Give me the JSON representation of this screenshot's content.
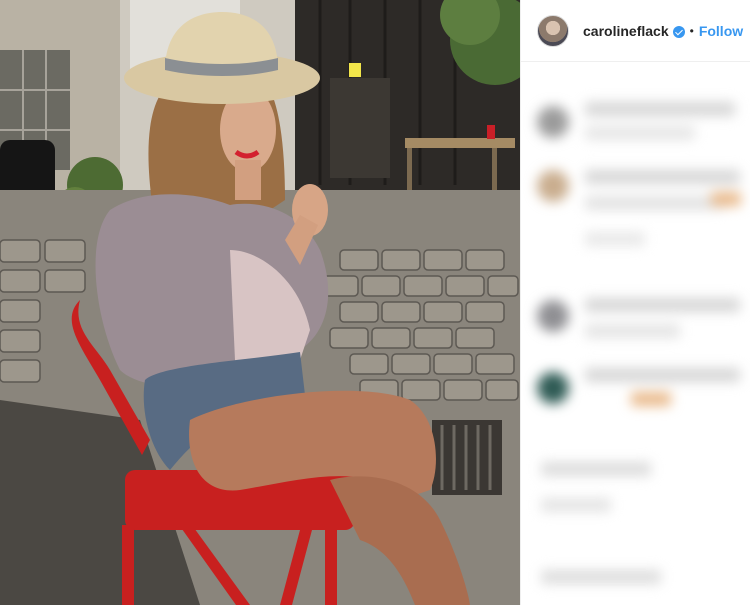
{
  "header": {
    "username": "carolineflack",
    "separator": "•",
    "follow_label": "Follow"
  },
  "icons": {
    "verified": "verified-badge-icon",
    "avatar": "profile-avatar"
  },
  "colors": {
    "follow_blue": "#3897f0",
    "username_text": "#262626",
    "chair_red": "#c8201f",
    "panel_border": "#efefef"
  }
}
